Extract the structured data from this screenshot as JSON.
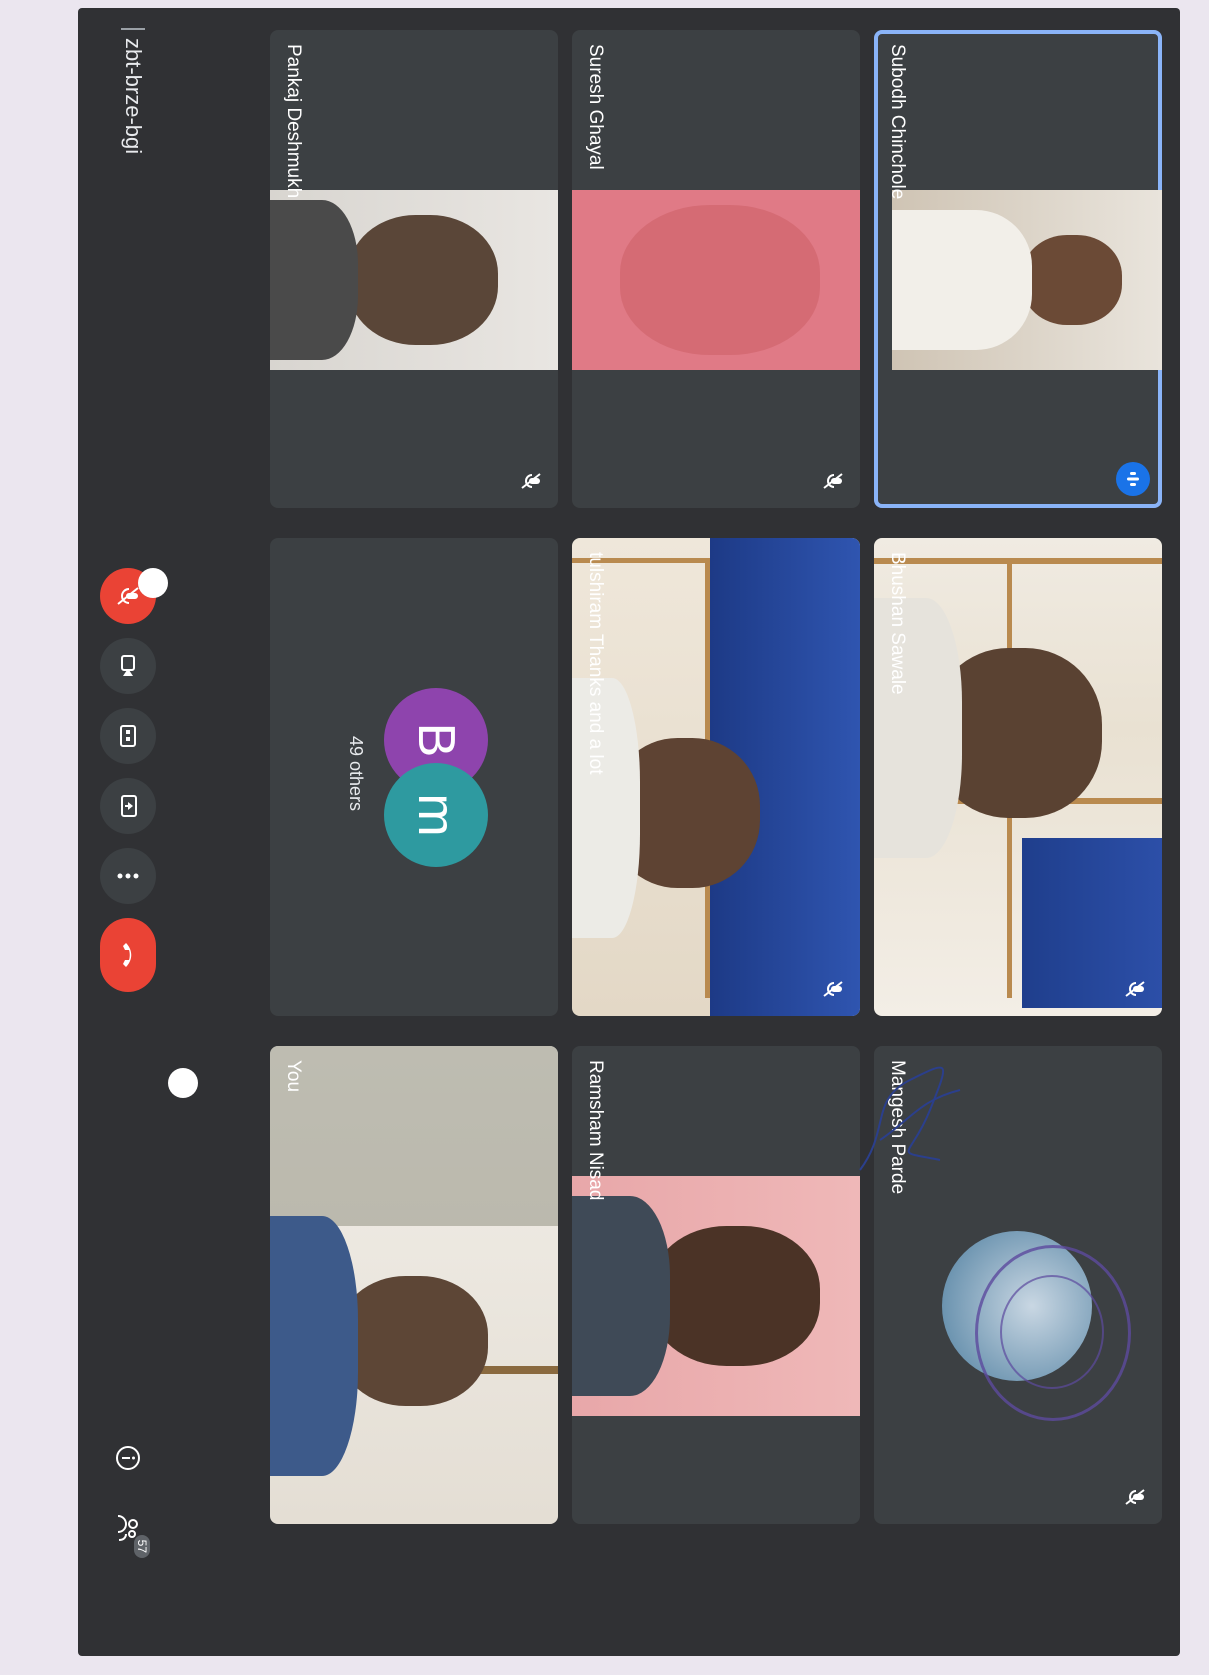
{
  "meeting": {
    "code": "zbt-brze-bgi",
    "participant_count": "57",
    "others_label": "49 others"
  },
  "participants": [
    {
      "name": "Subodh Chinchole"
    },
    {
      "name": "Bhushan Sawale"
    },
    {
      "name": "Mangesh Parde"
    },
    {
      "name": "Suresh Ghayal"
    },
    {
      "name": "tulshiram Thanks and a lot"
    },
    {
      "name": "Ramsham Nisad"
    },
    {
      "name": "Pankaj Deshmukh"
    },
    {
      "name": "You"
    }
  ],
  "avatars": [
    {
      "letter": "B",
      "color": "#8e44ad"
    },
    {
      "letter": "m",
      "color": "#2e9aa0"
    }
  ],
  "colors": {
    "background": "#303134",
    "tile": "#3c4043",
    "active_border": "#8ab4f8",
    "hangup": "#ea4335",
    "stamp": "#5c4a9e"
  },
  "icons": [
    "mic-off-icon",
    "speaking-icon",
    "camera-icon",
    "captions-icon",
    "present-icon",
    "more-icon",
    "hangup-icon",
    "info-icon",
    "people-icon"
  ]
}
